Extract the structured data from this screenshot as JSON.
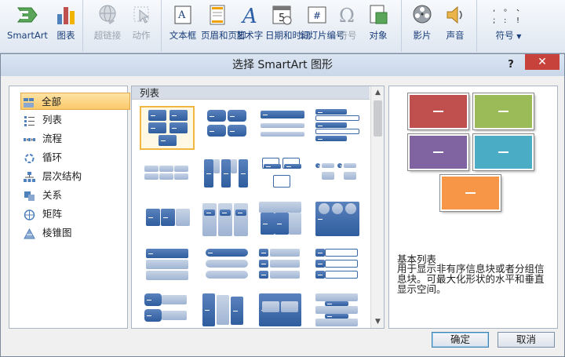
{
  "ribbon": {
    "groups": [
      {
        "items": [
          {
            "name": "smartart",
            "label": "SmartArt",
            "icon": "smartart-icon",
            "disabled": false
          },
          {
            "name": "chart",
            "label": "图表",
            "icon": "chart-icon",
            "disabled": false
          }
        ]
      },
      {
        "items": [
          {
            "name": "hyperlink",
            "label": "超链接",
            "icon": "hyperlink-icon",
            "disabled": true
          },
          {
            "name": "action",
            "label": "动作",
            "icon": "action-icon",
            "disabled": true
          }
        ]
      },
      {
        "items": [
          {
            "name": "textbox",
            "label": "文本框",
            "icon": "textbox-icon",
            "disabled": false
          },
          {
            "name": "header-footer",
            "label": "页眉和页脚",
            "icon": "header-footer-icon",
            "disabled": false
          },
          {
            "name": "wordart",
            "label": "艺术字",
            "icon": "wordart-icon",
            "disabled": false
          },
          {
            "name": "datetime",
            "label": "日期和时间",
            "icon": "calendar-icon",
            "disabled": false
          },
          {
            "name": "slide-number",
            "label": "幻灯片编号",
            "icon": "slide-number-icon",
            "disabled": false
          },
          {
            "name": "symbol",
            "label": "符号",
            "icon": "omega-icon",
            "disabled": true
          },
          {
            "name": "object",
            "label": "对象",
            "icon": "object-icon",
            "disabled": false
          }
        ]
      },
      {
        "items": [
          {
            "name": "movie",
            "label": "影片",
            "icon": "film-reel-icon",
            "disabled": false
          },
          {
            "name": "sound",
            "label": "声音",
            "icon": "speaker-icon",
            "disabled": false
          }
        ]
      },
      {
        "items": [
          {
            "name": "symbols-gallery",
            "label": "符号",
            "icon": "symbols-gallery-icon",
            "disabled": false
          }
        ]
      }
    ]
  },
  "dialog": {
    "title": "选择 SmartArt 图形",
    "help": "?",
    "close": "✕",
    "categories": [
      {
        "label": "全部",
        "icon": "all-icon",
        "selected": true
      },
      {
        "label": "列表",
        "icon": "list-icon",
        "selected": false
      },
      {
        "label": "流程",
        "icon": "process-icon",
        "selected": false
      },
      {
        "label": "循环",
        "icon": "cycle-icon",
        "selected": false
      },
      {
        "label": "层次结构",
        "icon": "hierarchy-icon",
        "selected": false
      },
      {
        "label": "关系",
        "icon": "relationship-icon",
        "selected": false
      },
      {
        "label": "矩阵",
        "icon": "matrix-icon",
        "selected": false
      },
      {
        "label": "棱锥图",
        "icon": "pyramid-icon",
        "selected": false
      }
    ],
    "layout_header": "列表",
    "preview": {
      "title": "基本列表",
      "description": "用于显示非有序信息块或者分组信息块。可最大化形状的水平和垂直显示空间。",
      "colors": [
        "#c0504d",
        "#9bbb59",
        "#8064a2",
        "#4bacc6",
        "#f79646"
      ]
    },
    "ok": "确定",
    "cancel": "取消"
  }
}
